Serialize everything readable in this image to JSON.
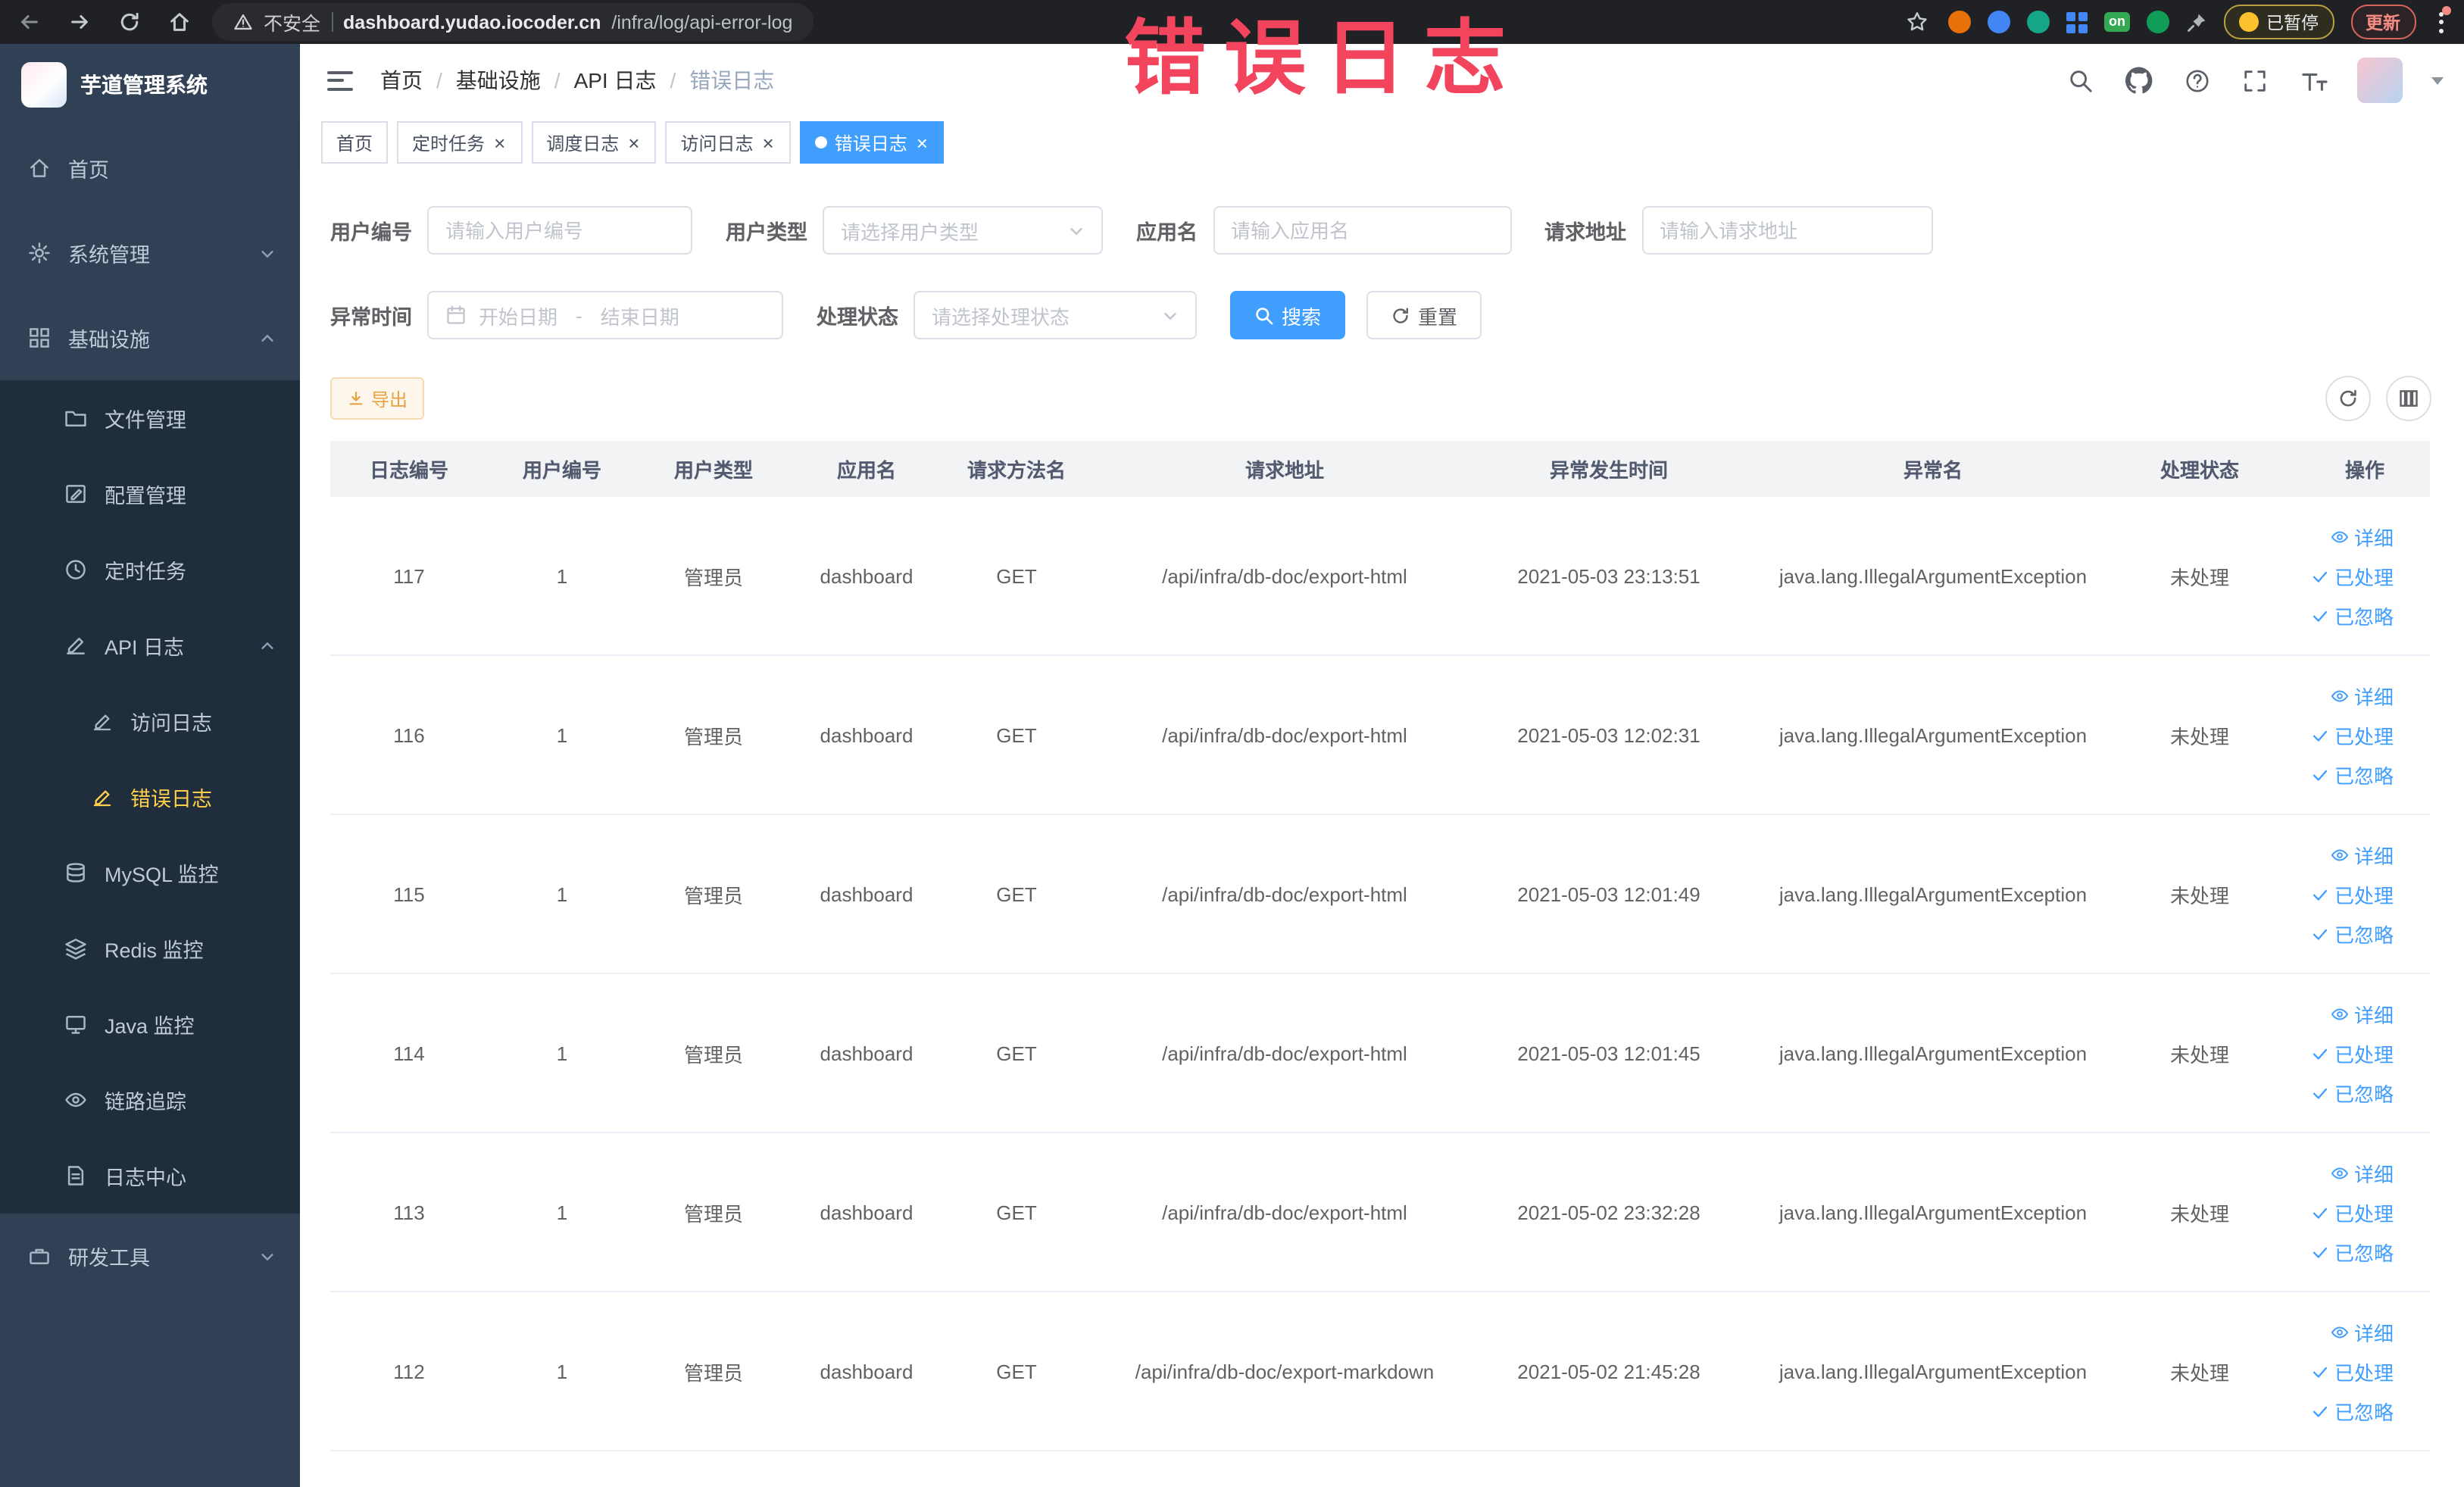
{
  "browser": {
    "security_text": "不安全",
    "url_host": "dashboard.yudao.iocoder.cn",
    "url_path": "/infra/log/api-error-log",
    "on_badge": "on",
    "paused_label": "已暂停",
    "update_label": "更新"
  },
  "annotation": {
    "text": "错误日志",
    "color": "#f2455d"
  },
  "sidebar": {
    "title": "芋道管理系统",
    "items": [
      {
        "label": "首页"
      },
      {
        "label": "系统管理"
      },
      {
        "label": "基础设施"
      },
      {
        "label": "文件管理"
      },
      {
        "label": "配置管理"
      },
      {
        "label": "定时任务"
      },
      {
        "label": "API 日志"
      },
      {
        "label": "访问日志"
      },
      {
        "label": "错误日志"
      },
      {
        "label": "MySQL 监控"
      },
      {
        "label": "Redis 监控"
      },
      {
        "label": "Java 监控"
      },
      {
        "label": "链路追踪"
      },
      {
        "label": "日志中心"
      },
      {
        "label": "研发工具"
      }
    ]
  },
  "breadcrumb": {
    "items": [
      "首页",
      "基础设施",
      "API 日志",
      "错误日志"
    ]
  },
  "tabs": {
    "items": [
      {
        "label": "首页"
      },
      {
        "label": "定时任务"
      },
      {
        "label": "调度日志"
      },
      {
        "label": "访问日志"
      },
      {
        "label": "错误日志"
      }
    ]
  },
  "filters": {
    "user_id": {
      "label": "用户编号",
      "placeholder": "请输入用户编号"
    },
    "user_type": {
      "label": "用户类型",
      "placeholder": "请选择用户类型"
    },
    "app_name": {
      "label": "应用名",
      "placeholder": "请输入应用名"
    },
    "request_url": {
      "label": "请求地址",
      "placeholder": "请输入请求地址"
    },
    "exception_time": {
      "label": "异常时间",
      "start_placeholder": "开始日期",
      "separator": "-",
      "end_placeholder": "结束日期"
    },
    "process_status": {
      "label": "处理状态",
      "placeholder": "请选择处理状态"
    },
    "search_label": "搜索",
    "reset_label": "重置"
  },
  "toolbar": {
    "export_label": "导出"
  },
  "table": {
    "columns": [
      "日志编号",
      "用户编号",
      "用户类型",
      "应用名",
      "请求方法名",
      "请求地址",
      "异常发生时间",
      "异常名",
      "处理状态",
      "操作"
    ],
    "rows": [
      {
        "log_id": "117",
        "user_id": "1",
        "user_type": "管理员",
        "app": "dashboard",
        "method": "GET",
        "url": "/api/infra/db-doc/export-html",
        "time": "2021-05-03 23:13:51",
        "exception": "java.lang.IllegalArgumentException",
        "status": "未处理"
      },
      {
        "log_id": "116",
        "user_id": "1",
        "user_type": "管理员",
        "app": "dashboard",
        "method": "GET",
        "url": "/api/infra/db-doc/export-html",
        "time": "2021-05-03 12:02:31",
        "exception": "java.lang.IllegalArgumentException",
        "status": "未处理"
      },
      {
        "log_id": "115",
        "user_id": "1",
        "user_type": "管理员",
        "app": "dashboard",
        "method": "GET",
        "url": "/api/infra/db-doc/export-html",
        "time": "2021-05-03 12:01:49",
        "exception": "java.lang.IllegalArgumentException",
        "status": "未处理"
      },
      {
        "log_id": "114",
        "user_id": "1",
        "user_type": "管理员",
        "app": "dashboard",
        "method": "GET",
        "url": "/api/infra/db-doc/export-html",
        "time": "2021-05-03 12:01:45",
        "exception": "java.lang.IllegalArgumentException",
        "status": "未处理"
      },
      {
        "log_id": "113",
        "user_id": "1",
        "user_type": "管理员",
        "app": "dashboard",
        "method": "GET",
        "url": "/api/infra/db-doc/export-html",
        "time": "2021-05-02 23:32:28",
        "exception": "java.lang.IllegalArgumentException",
        "status": "未处理"
      },
      {
        "log_id": "112",
        "user_id": "1",
        "user_type": "管理员",
        "app": "dashboard",
        "method": "GET",
        "url": "/api/infra/db-doc/export-markdown",
        "time": "2021-05-02 21:45:28",
        "exception": "java.lang.IllegalArgumentException",
        "status": "未处理"
      }
    ]
  },
  "actions": {
    "detail": "详细",
    "processed": "已处理",
    "ignored": "已忽略"
  }
}
